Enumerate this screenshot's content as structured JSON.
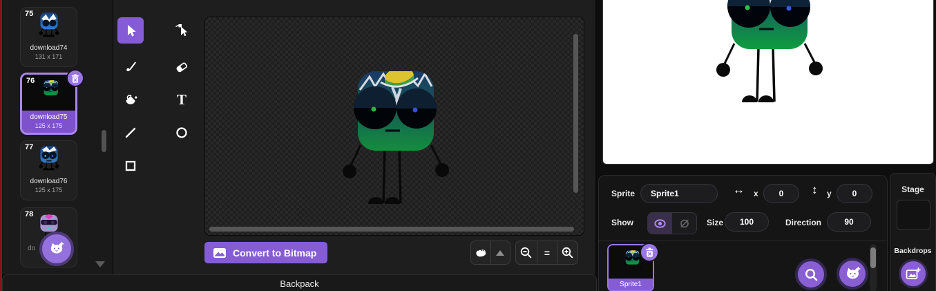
{
  "colors": {
    "accent": "#855cd6",
    "accent_light": "#9a76e4",
    "edge_strip": "#8a1020",
    "stage_background": "#ffffff",
    "pupil_left": "#27c840",
    "pupil_right": "#3a57e8"
  },
  "costume_panel": {
    "items": [
      {
        "number": "75",
        "name": "download74",
        "size": "131 x 171",
        "selected": false
      },
      {
        "number": "76",
        "name": "download75",
        "size": "125 x 175",
        "selected": true
      },
      {
        "number": "77",
        "name": "download76",
        "size": "125 x 175",
        "selected": false
      },
      {
        "number": "78",
        "name": "do",
        "size": "",
        "selected": false
      }
    ],
    "icons": [
      "trash-icon",
      "add-costume-cat-icon",
      "caret-down-icon"
    ]
  },
  "paint": {
    "tools": [
      "select",
      "reshape",
      "brush",
      "eraser",
      "fill",
      "text",
      "line",
      "circle",
      "rectangle"
    ],
    "selected_tool": "select",
    "convert_button_label": "Convert to Bitmap",
    "zoom": {
      "reset_label": "=",
      "icons": [
        "paw-icon",
        "caret-up-icon",
        "zoom-out-icon",
        "zoom-in-icon"
      ]
    }
  },
  "sprite_info": {
    "sprite_label": "Sprite",
    "name_value": "Sprite1",
    "x_label": "x",
    "x_value": "0",
    "y_label": "y",
    "y_value": "0",
    "show_label": "Show",
    "size_label": "Size",
    "size_value": "100",
    "direction_label": "Direction",
    "direction_value": "90",
    "icons": [
      "arrow-horizontal-icon",
      "arrow-vertical-icon",
      "eye-visible-icon",
      "eye-hidden-icon"
    ]
  },
  "sprite_list": {
    "sprite_name": "Sprite1",
    "icons": [
      "trash-icon",
      "search-icon",
      "add-sprite-cat-icon"
    ]
  },
  "stage_panel": {
    "title": "Stage",
    "backdrops_label": "Backdrops",
    "icons": [
      "add-backdrop-image-icon"
    ]
  },
  "backpack": {
    "label": "Backpack"
  }
}
